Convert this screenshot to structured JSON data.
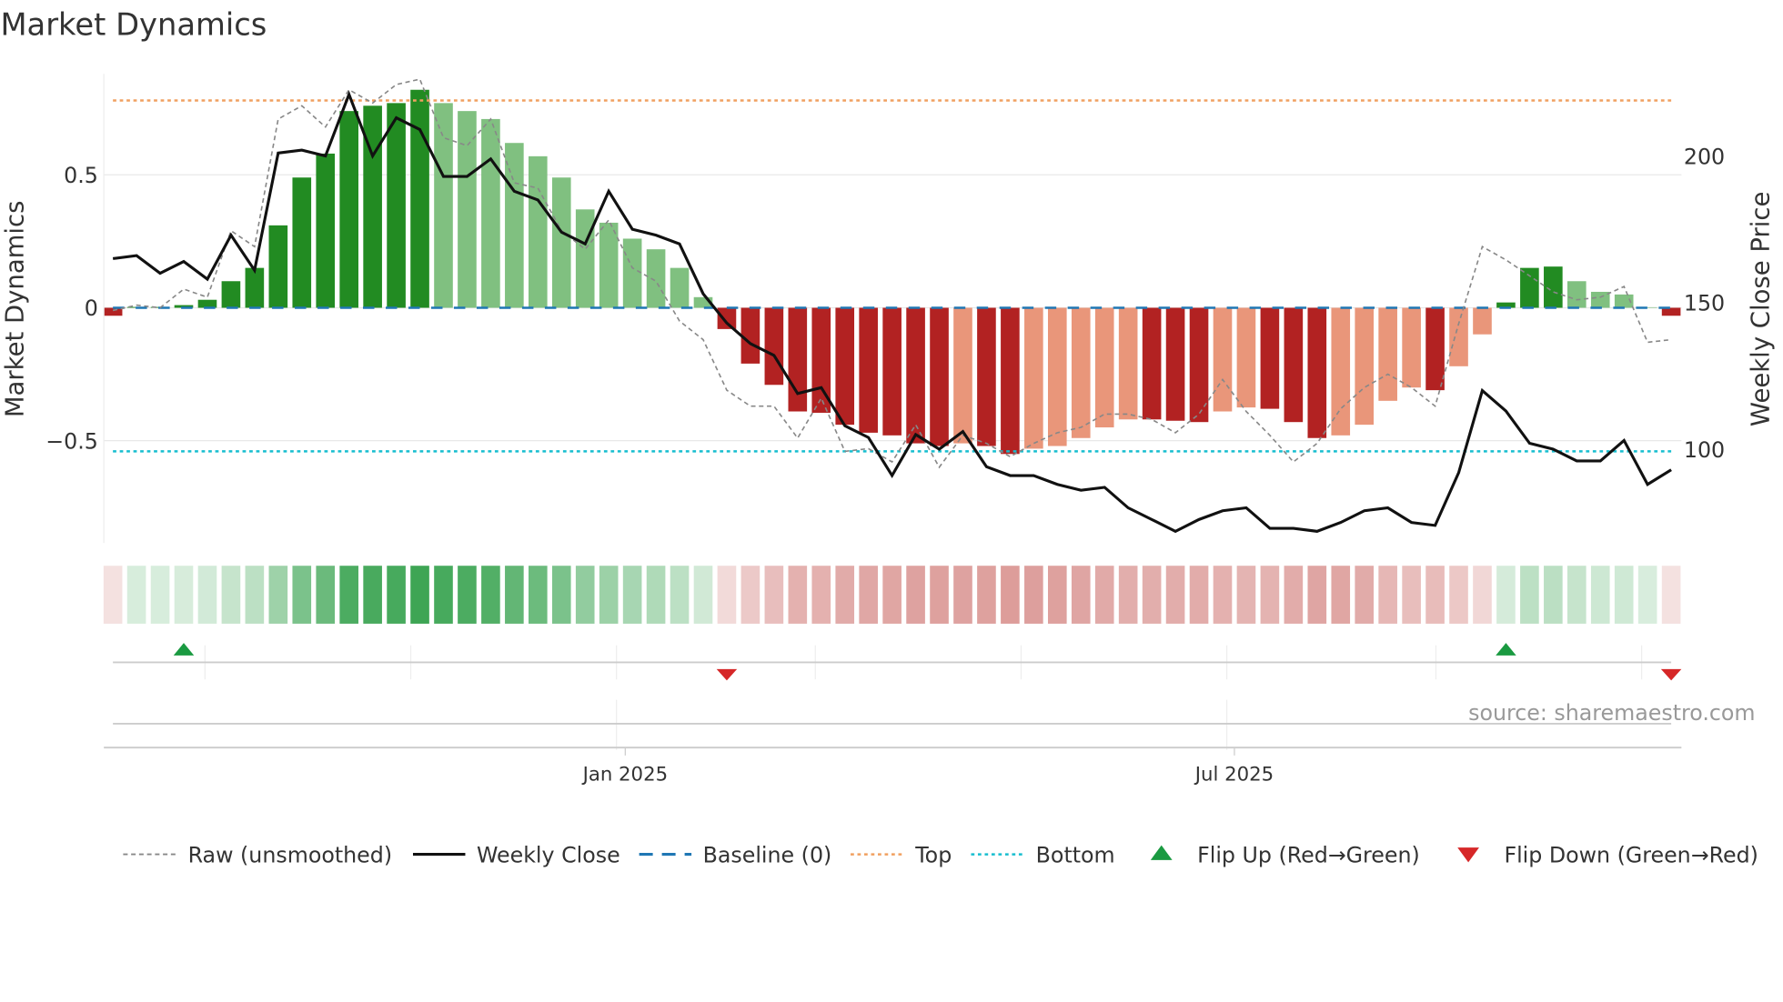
{
  "chart_data": {
    "type": "bar",
    "title": "Market Dynamics",
    "ylabel": "Market Dynamics",
    "y2label": "Weekly Close Price",
    "ylim": [
      -0.885,
      0.88
    ],
    "y2lim": [
      68,
      228
    ],
    "yticks": [
      {
        "v": 0.5,
        "label": "0.5"
      },
      {
        "v": 0,
        "label": "0"
      },
      {
        "v": -0.5,
        "label": "−0.5"
      }
    ],
    "y2ticks": [
      {
        "v": 200,
        "label": "200"
      },
      {
        "v": 150,
        "label": "150"
      },
      {
        "v": 100,
        "label": "100"
      }
    ],
    "xticks": [
      {
        "week": 21.7,
        "label": "Jan 2025"
      },
      {
        "week": 47.5,
        "label": "Jul 2025"
      }
    ],
    "top_level": 0.78,
    "bottom_level": -0.54,
    "baseline": 0,
    "dynamics": [
      -0.03,
      0.003,
      0.003,
      0.01,
      0.03,
      0.1,
      0.15,
      0.31,
      0.49,
      0.58,
      0.74,
      0.76,
      0.77,
      0.82,
      0.77,
      0.74,
      0.71,
      0.62,
      0.57,
      0.49,
      0.37,
      0.32,
      0.26,
      0.22,
      0.15,
      0.04,
      -0.08,
      -0.21,
      -0.29,
      -0.39,
      -0.395,
      -0.44,
      -0.47,
      -0.48,
      -0.51,
      -0.52,
      -0.51,
      -0.52,
      -0.55,
      -0.53,
      -0.52,
      -0.49,
      -0.45,
      -0.42,
      -0.42,
      -0.425,
      -0.43,
      -0.39,
      -0.375,
      -0.38,
      -0.43,
      -0.49,
      -0.48,
      -0.44,
      -0.35,
      -0.3,
      -0.31,
      -0.22,
      -0.1,
      0.02,
      0.15,
      0.155,
      0.1,
      0.06,
      0.05,
      0.002,
      -0.03
    ],
    "raw": [
      -0.01,
      0.01,
      0,
      0.07,
      0.04,
      0.29,
      0.23,
      0.71,
      0.76,
      0.68,
      0.82,
      0.77,
      0.84,
      0.86,
      0.64,
      0.61,
      0.71,
      0.47,
      0.45,
      0.29,
      0.22,
      0.33,
      0.15,
      0.1,
      -0.05,
      -0.12,
      -0.31,
      -0.37,
      -0.37,
      -0.49,
      -0.34,
      -0.54,
      -0.53,
      -0.58,
      -0.44,
      -0.6,
      -0.48,
      -0.51,
      -0.56,
      -0.51,
      -0.47,
      -0.45,
      -0.4,
      -0.4,
      -0.42,
      -0.47,
      -0.4,
      -0.27,
      -0.39,
      -0.48,
      -0.58,
      -0.51,
      -0.38,
      -0.3,
      -0.25,
      -0.3,
      -0.37,
      -0.06,
      0.23,
      0.18,
      0.12,
      0.06,
      0.03,
      0.04,
      0.08,
      -0.13,
      -0.12
    ],
    "weekly_close": [
      165,
      166,
      160,
      164,
      158,
      173,
      161,
      201,
      202,
      200,
      221,
      200,
      213,
      209,
      193,
      193,
      199,
      188,
      185,
      174,
      170,
      188,
      175,
      173,
      170,
      153,
      143,
      136,
      132,
      119,
      121,
      108,
      104,
      91,
      105,
      100,
      106,
      94,
      91,
      91,
      88,
      86,
      87,
      80,
      76,
      72,
      76,
      79,
      80,
      73,
      73,
      72,
      75,
      79,
      80,
      75,
      74,
      92,
      120,
      113,
      102,
      100,
      96,
      96,
      103,
      88,
      93
    ],
    "flips": [
      {
        "week": 3,
        "dir": "up"
      },
      {
        "week": 26,
        "dir": "down"
      },
      {
        "week": 59,
        "dir": "up"
      },
      {
        "week": 66,
        "dir": "down"
      }
    ],
    "colors": {
      "strong_pos": "#228b22",
      "weak_pos": "#80c080",
      "strong_neg": "#b22222",
      "weak_neg": "#e9967a",
      "top": "#f0a060",
      "bottom": "#17becf",
      "baseline": "#1f77b4",
      "flip_up": "#1a9a41",
      "flip_down": "#d62728"
    },
    "legend": [
      "Raw (unsmoothed)",
      "Weekly Close",
      "Baseline (0)",
      "Top",
      "Bottom",
      "Flip Up (Red→Green)",
      "Flip Down (Green→Red)"
    ],
    "source": "source: sharemaestro.com"
  }
}
